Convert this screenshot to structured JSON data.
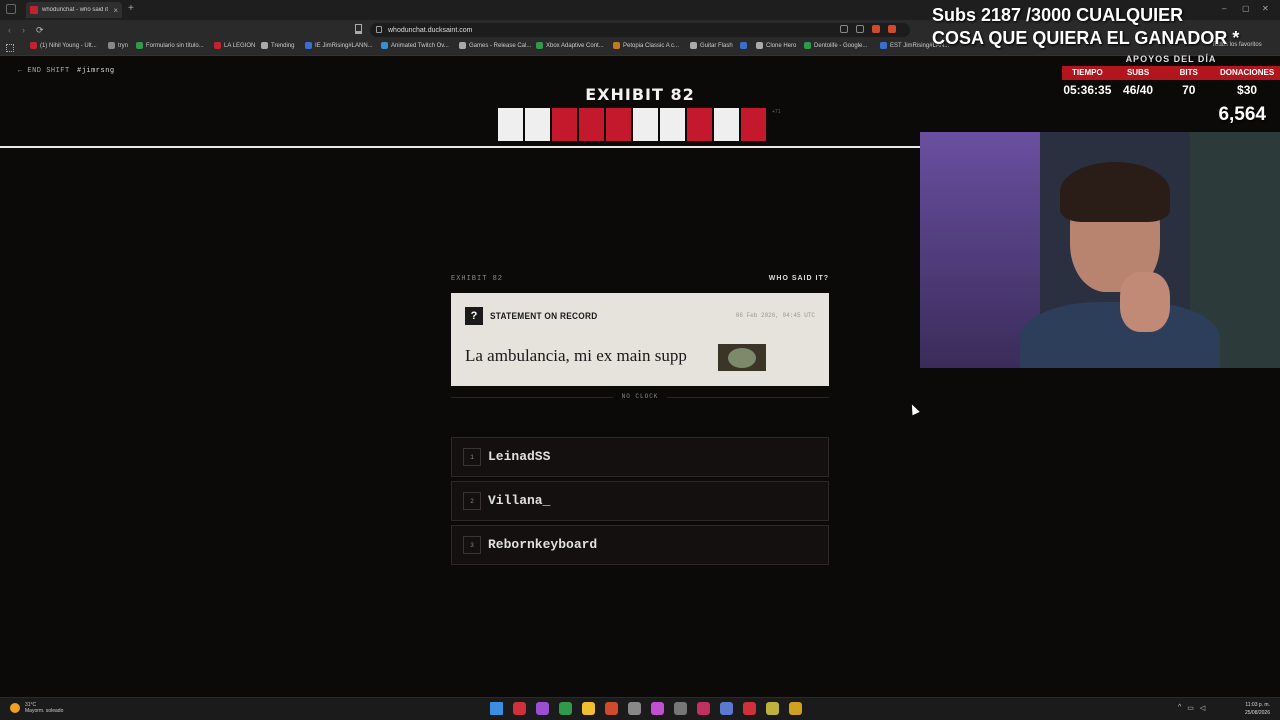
{
  "browser": {
    "tab_title": "whodunchat - who said it in y",
    "close_tab": "×",
    "new_tab": "+",
    "url": "whodunchat.ducksaint.com",
    "window_controls": [
      "–",
      "▢",
      "✕"
    ],
    "bookmarks": [
      {
        "label": "(1) Nihil Young - Ult...",
        "color": "#c2232e"
      },
      {
        "label": "tryn",
        "color": "#888888"
      },
      {
        "label": "Formulario sin título...",
        "color": "#2e9a4a"
      },
      {
        "label": "LA LEGION",
        "color": "#c2232e"
      },
      {
        "label": "Trending",
        "color": "#aaaaaa"
      },
      {
        "label": "IE JimRising#LANN...",
        "color": "#3a6fd0"
      },
      {
        "label": "Animated Twitch Ov...",
        "color": "#3a8fd0"
      },
      {
        "label": "Games - Release Cal...",
        "color": "#aaaaaa"
      },
      {
        "label": "Xbox Adaptive Cont...",
        "color": "#2e9a4a"
      },
      {
        "label": "Petopia Classic A c...",
        "color": "#c07a20"
      },
      {
        "label": "Guitar Flash",
        "color": "#aaaaaa"
      },
      {
        "label": "",
        "color": "#3a6fd0"
      },
      {
        "label": "Clone Hero",
        "color": "#aaaaaa"
      },
      {
        "label": "Dentolife - Google...",
        "color": "#2e9a4a"
      },
      {
        "label": "EST JimRising#LAN...",
        "color": "#3a6fd0"
      }
    ],
    "all_bookmarks": "Todos los favoritos"
  },
  "page": {
    "end_shift": "← END SHIFT",
    "username": "#jimrsng",
    "exhibit_title": "EXHIBIT 82",
    "tiles": [
      "w",
      "w",
      "r",
      "r",
      "r",
      "w",
      "w",
      "r",
      "w",
      "r"
    ],
    "tile_extra": "+71",
    "section_left": "EXHIBIT 82",
    "section_right": "WHO SAID IT?",
    "card": {
      "icon": "?",
      "label": "STATEMENT ON RECORD",
      "date": "06 Feb 2026, 04:45 UTC",
      "statement": "La ambulancia, mi ex main supp"
    },
    "no_clock": "NO CLOCK",
    "options": [
      {
        "num": "1",
        "name": "LeinadSS"
      },
      {
        "num": "2",
        "name": "Villana_"
      },
      {
        "num": "3",
        "name": "Rebornkeyboard"
      }
    ]
  },
  "overlay": {
    "line1": "Subs 2187 /3000 CUALQUIER",
    "line2": "COSA QUE QUIERA EL GANADOR *",
    "stats_title": "APOYOS DEL DÍA",
    "stats": [
      {
        "label": "TIEMPO",
        "value": "05:36:35"
      },
      {
        "label": "SUBS",
        "value": "46/40"
      },
      {
        "label": "BITS",
        "value": "70"
      },
      {
        "label": "DONACIONES",
        "value": "$30"
      }
    ],
    "big_count": "6,564"
  },
  "taskbar": {
    "temp": "31°C",
    "weather": "Mayorm. soleado",
    "time": "11:03 p. m.",
    "date": "25/08/2026",
    "app_colors": [
      "#3a8fe0",
      "#d0303a",
      "#9a4fd0",
      "#2e9a4a",
      "#f0c030",
      "#d04a2c",
      "#888888",
      "#c050d0",
      "#777777",
      "#c03060",
      "#5a7ad0",
      "#d0303a",
      "#c0b040",
      "#d0a020"
    ]
  }
}
